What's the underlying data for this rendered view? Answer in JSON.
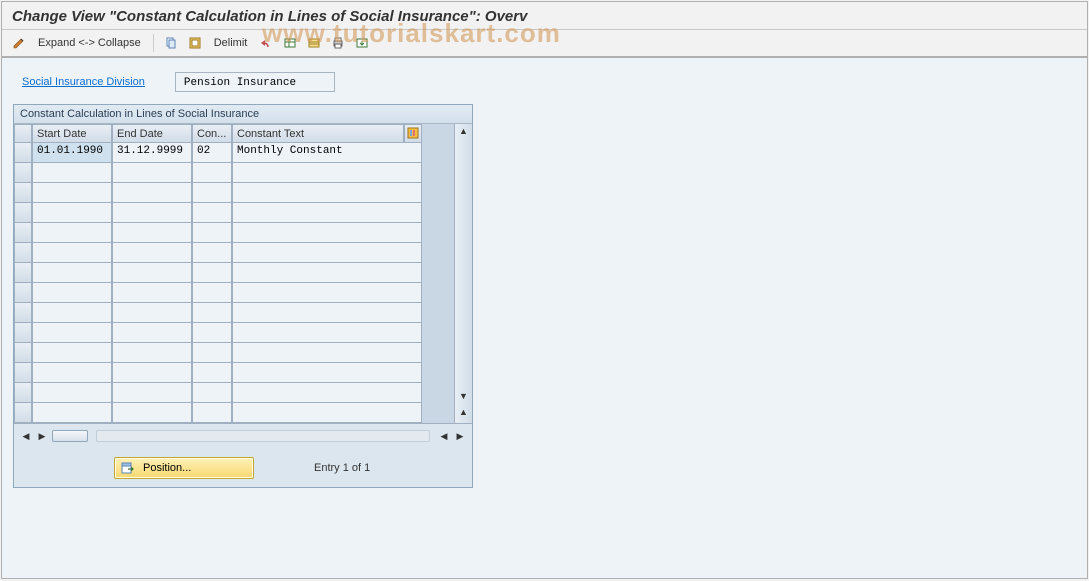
{
  "title": "Change View \"Constant Calculation in Lines of Social Insurance\": Overv",
  "toolbar": {
    "expand_collapse": "Expand <-> Collapse",
    "delimit": "Delimit"
  },
  "field": {
    "label": "Social Insurance Division",
    "value": "Pension Insurance"
  },
  "panel": {
    "title": "Constant Calculation in Lines of Social Insurance",
    "columns": {
      "start_date": "Start Date",
      "end_date": "End Date",
      "con": "Con...",
      "constant_text": "Constant Text"
    },
    "rows": [
      {
        "start_date": "01.01.1990",
        "end_date": "31.12.9999",
        "con": "02",
        "constant_text": "Monthly Constant"
      }
    ],
    "empty_row_count": 13
  },
  "footer": {
    "position_btn": "Position...",
    "entry_label": "Entry 1 of 1"
  },
  "watermark": "www.tutorialskart.com"
}
